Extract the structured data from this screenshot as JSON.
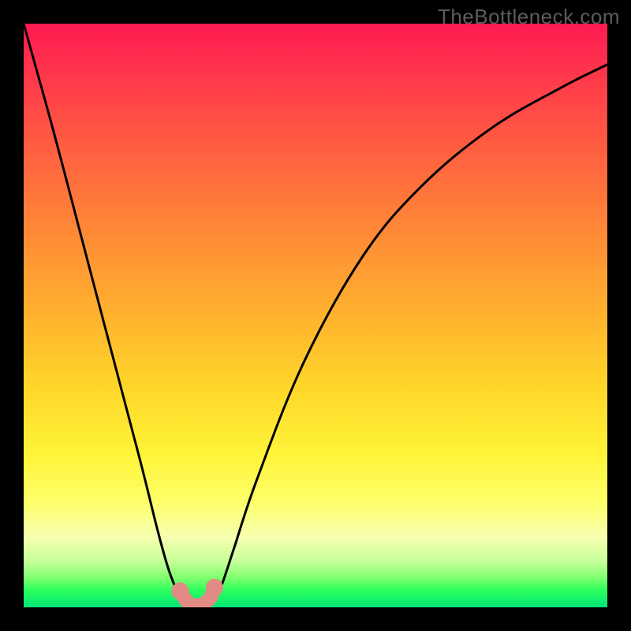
{
  "watermark": "TheBottleneck.com",
  "chart_data": {
    "type": "line",
    "title": "",
    "xlabel": "",
    "ylabel": "",
    "xlim": [
      0,
      100
    ],
    "ylim": [
      0,
      100
    ],
    "series": [
      {
        "name": "bottleneck-curve",
        "x": [
          0,
          5,
          10,
          15,
          20,
          23,
          25,
          27,
          28.5,
          30,
          31.5,
          33,
          34,
          36,
          40,
          48,
          58,
          68,
          80,
          92,
          100
        ],
        "y": [
          100,
          82,
          63,
          44,
          25,
          13,
          6,
          1.5,
          0.5,
          0,
          0.5,
          2,
          4,
          10,
          22,
          42,
          60,
          72,
          82,
          89,
          93
        ]
      }
    ],
    "markers": {
      "name": "recommended-range",
      "color": "#e28b84",
      "points": [
        {
          "x": 26.8,
          "y": 2.8
        },
        {
          "x": 27.8,
          "y": 1.2
        },
        {
          "x": 28.5,
          "y": 0.5
        },
        {
          "x": 29.5,
          "y": 0.3
        },
        {
          "x": 30.8,
          "y": 0.5
        },
        {
          "x": 32.0,
          "y": 1.6
        },
        {
          "x": 32.7,
          "y": 3.4
        }
      ]
    },
    "gradient_meaning": "background color goes from red (high bottleneck) at top to green (no bottleneck) at bottom"
  }
}
